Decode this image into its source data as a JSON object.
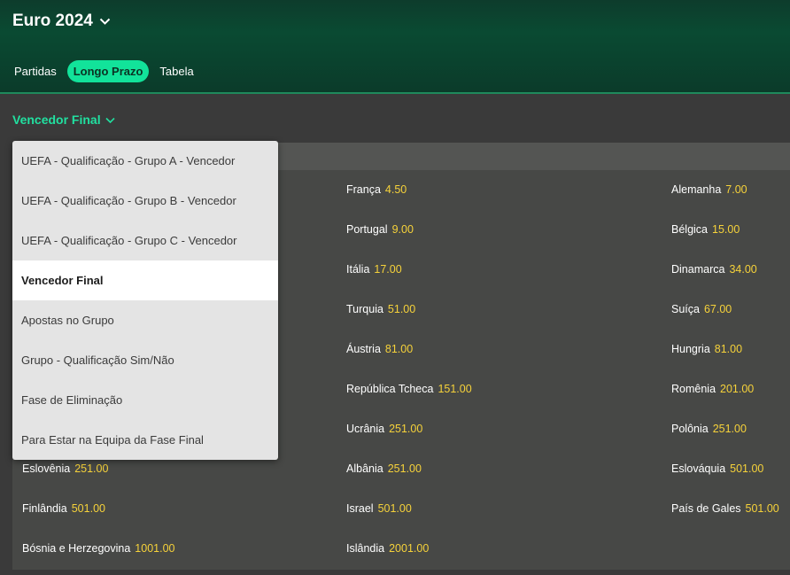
{
  "header": {
    "title": "Euro 2024",
    "tabs": [
      {
        "label": "Partidas",
        "active": false
      },
      {
        "label": "Longo Prazo",
        "active": true
      },
      {
        "label": "Tabela",
        "active": false
      }
    ]
  },
  "market": {
    "title": "Vencedor Final"
  },
  "dropdown": {
    "items": [
      {
        "label": "UEFA - Qualificação - Grupo A - Vencedor",
        "selected": false
      },
      {
        "label": "UEFA - Qualificação - Grupo B - Vencedor",
        "selected": false
      },
      {
        "label": "UEFA - Qualificação - Grupo C - Vencedor",
        "selected": false
      },
      {
        "label": "Vencedor Final",
        "selected": true
      },
      {
        "label": "Apostas no Grupo",
        "selected": false
      },
      {
        "label": "Grupo - Qualificação Sim/Não",
        "selected": false
      },
      {
        "label": "Fase de Eliminação",
        "selected": false
      },
      {
        "label": "Para Estar na Equipa da Fase Final",
        "selected": false
      }
    ]
  },
  "selections": {
    "col1": [
      {
        "name": "Eslovênia",
        "odds": "251.00"
      },
      {
        "name": "Finlândia",
        "odds": "501.00"
      },
      {
        "name": "Bósnia e Herzegovina",
        "odds": "1001.00"
      }
    ],
    "col2": [
      {
        "name": "França",
        "odds": "4.50"
      },
      {
        "name": "Portugal",
        "odds": "9.00"
      },
      {
        "name": "Itália",
        "odds": "17.00"
      },
      {
        "name": "Turquia",
        "odds": "51.00"
      },
      {
        "name": "Áustria",
        "odds": "81.00"
      },
      {
        "name": "República Tcheca",
        "odds": "151.00"
      },
      {
        "name": "Ucrânia",
        "odds": "251.00"
      },
      {
        "name": "Albânia",
        "odds": "251.00"
      },
      {
        "name": "Israel",
        "odds": "501.00"
      },
      {
        "name": "Islândia",
        "odds": "2001.00"
      }
    ],
    "col3": [
      {
        "name": "Alemanha",
        "odds": "7.00"
      },
      {
        "name": "Bélgica",
        "odds": "15.00"
      },
      {
        "name": "Dinamarca",
        "odds": "34.00"
      },
      {
        "name": "Suíça",
        "odds": "67.00"
      },
      {
        "name": "Hungria",
        "odds": "81.00"
      },
      {
        "name": "Romênia",
        "odds": "201.00"
      },
      {
        "name": "Polônia",
        "odds": "251.00"
      },
      {
        "name": "Eslováquia",
        "odds": "501.00"
      },
      {
        "name": "País de Gales",
        "odds": "501.00"
      }
    ]
  },
  "colors": {
    "accent": "#12e39a",
    "market_title": "#21e0a0",
    "odds": "#f6d23a",
    "header_bg": "#0a4a32",
    "panel_bg": "#474846"
  },
  "icons": {
    "title_chevron": "chevron-down-icon",
    "market_chevron": "chevron-down-icon"
  }
}
